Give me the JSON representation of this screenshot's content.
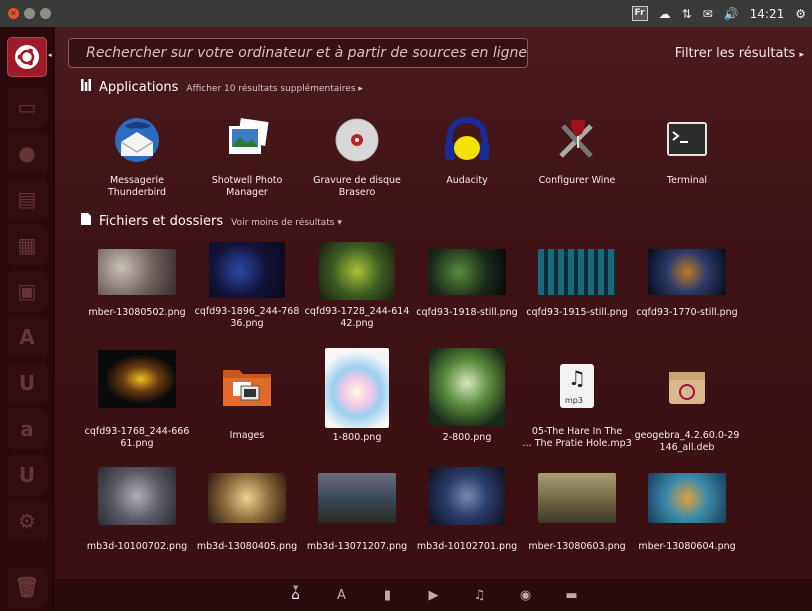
{
  "topbar": {
    "time": "14:21",
    "keyboard": "Fr"
  },
  "search": {
    "placeholder": "Rechercher sur votre ordinateur et à partir de sources en ligne"
  },
  "filter_label": "Filtrer les résultats",
  "apps_section": {
    "title": "Applications",
    "more": "Afficher 10 résultats supplémentaires"
  },
  "apps": [
    {
      "label_1": "Messagerie",
      "label_2": "Thunderbird",
      "icon": "thunderbird-icon"
    },
    {
      "label_1": "Shotwell Photo",
      "label_2": "Manager",
      "icon": "shotwell-icon"
    },
    {
      "label_1": "Gravure de disque",
      "label_2": "Brasero",
      "icon": "brasero-icon"
    },
    {
      "label_1": "Audacity",
      "label_2": "",
      "icon": "audacity-icon"
    },
    {
      "label_1": "Configurer Wine",
      "label_2": "",
      "icon": "wine-icon"
    },
    {
      "label_1": "Terminal",
      "label_2": "",
      "icon": "terminal-icon"
    }
  ],
  "files_section": {
    "title": "Fichiers et dossiers",
    "less": "Voir moins de résultats"
  },
  "files_row1": [
    {
      "label_1": "mber-13080502.png",
      "label_2": ""
    },
    {
      "label_1": "cqfd93-1896_244-768",
      "label_2": "36.png"
    },
    {
      "label_1": "cqfd93-1728_244-614",
      "label_2": "42.png"
    },
    {
      "label_1": "cqfd93-1918-still.png",
      "label_2": ""
    },
    {
      "label_1": "cqfd93-1915-still.png",
      "label_2": ""
    },
    {
      "label_1": "cqfd93-1770-still.png",
      "label_2": ""
    }
  ],
  "files_row2": [
    {
      "label_1": "cqfd93-1768_244-666",
      "label_2": "61.png"
    },
    {
      "label_1": "Images",
      "label_2": ""
    },
    {
      "label_1": "1-800.png",
      "label_2": ""
    },
    {
      "label_1": "2-800.png",
      "label_2": ""
    },
    {
      "label_1": "05-The Hare In The",
      "label_2": "… The Pratie Hole.mp3"
    },
    {
      "label_1": "geogebra_4.2.60.0-29",
      "label_2": "146_all.deb"
    }
  ],
  "files_row3": [
    {
      "label_1": "mb3d-10100702.png",
      "label_2": ""
    },
    {
      "label_1": "mb3d-13080405.png",
      "label_2": ""
    },
    {
      "label_1": "mb3d-13071207.png",
      "label_2": ""
    },
    {
      "label_1": "mb3d-10102701.png",
      "label_2": ""
    },
    {
      "label_1": "mber-13080603.png",
      "label_2": ""
    },
    {
      "label_1": "mber-13080604.png",
      "label_2": ""
    }
  ],
  "mp3_badge": "mp3",
  "colors": {
    "accent": "#9c1c2a",
    "dash_bg": "#3e1216",
    "topbar": "#3a3a38"
  }
}
